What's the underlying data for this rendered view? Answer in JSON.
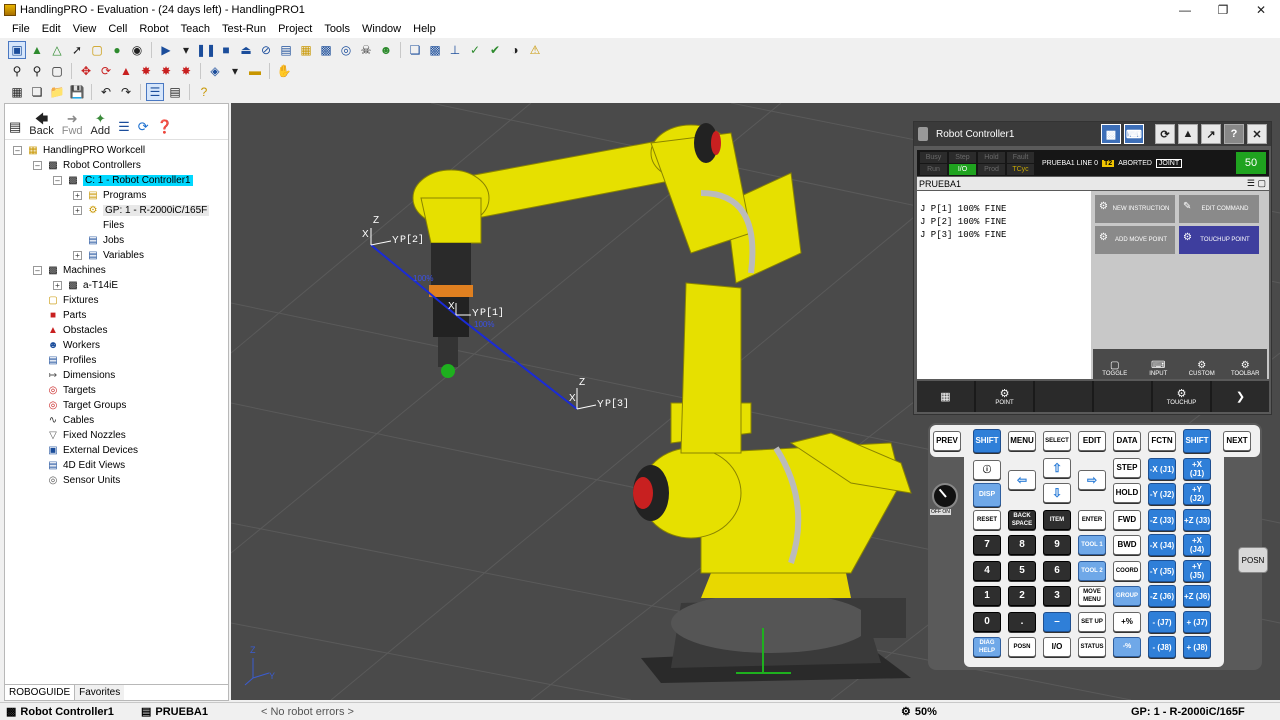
{
  "window": {
    "title": "HandlingPRO - Evaluation - (24 days left) - HandlingPRO1"
  },
  "menu": [
    "File",
    "Edit",
    "View",
    "Cell",
    "Robot",
    "Teach",
    "Test-Run",
    "Project",
    "Tools",
    "Window",
    "Help"
  ],
  "nav": {
    "back": "Back",
    "fwd": "Fwd",
    "add": "Add"
  },
  "tree": {
    "root": "HandlingPRO Workcell",
    "robot_controllers": "Robot Controllers",
    "controller": "C: 1 - Robot Controller1",
    "programs": "Programs",
    "gp": "GP: 1 - R-2000iC/165F",
    "files": "Files",
    "jobs": "Jobs",
    "variables": "Variables",
    "machines": "Machines",
    "machine_child": "a-T14iE",
    "fixtures": "Fixtures",
    "parts": "Parts",
    "obstacles": "Obstacles",
    "workers": "Workers",
    "profiles": "Profiles",
    "dimensions": "Dimensions",
    "targets": "Targets",
    "target_groups": "Target Groups",
    "cables": "Cables",
    "fixed_nozzles": "Fixed Nozzles",
    "external_devices": "External Devices",
    "edit_views": "4D Edit Views",
    "sensor_units": "Sensor Units"
  },
  "left_tabs": {
    "roboguide": "ROBOGUIDE",
    "favorites": "Favorites"
  },
  "viewport": {
    "labels": {
      "p1": "P[1]",
      "p2": "P[2]",
      "p3": "P[3]",
      "y_letter": "Y",
      "z_letter": "Z",
      "x_letter": "X",
      "speed1": "100%",
      "speed2": "100%"
    },
    "triad": {
      "z": "Z",
      "y": "Y"
    }
  },
  "pendant": {
    "title": "Robot Controller1",
    "leds": [
      "Busy",
      "Step",
      "Hold",
      "Fault",
      "Run",
      "I/O",
      "Prod",
      "TCyc"
    ],
    "leds_on": [
      "I/O"
    ],
    "status_prog": "PRUEBA1 LINE 0",
    "status_t2": "T2",
    "status_state": "ABORTED",
    "status_joint": "JOINT",
    "override": "50",
    "program_name": "PRUEBA1",
    "lines": [
      "J  P[1] 100% FINE",
      "J  P[2] 100% FINE",
      "J  P[3] 100% FINE"
    ],
    "commands": [
      {
        "label": "NEW INSTRUCTION",
        "blue": false
      },
      {
        "label": "EDIT COMMAND",
        "blue": false
      },
      {
        "label": "ADD MOVE POINT",
        "blue": false
      },
      {
        "label": "TOUCHUP POINT",
        "blue": true
      }
    ],
    "mini": [
      "TOGGLE",
      "INPUT",
      "CUSTOM",
      "TOOLBAR"
    ],
    "fkeys": [
      "",
      "POINT",
      "",
      "",
      "TOUCHUP",
      ""
    ]
  },
  "keypad": {
    "prev": "PREV",
    "shift": "SHIFT",
    "menu": "MENU",
    "select": "SELECT",
    "edit": "EDIT",
    "data": "DATA",
    "fctn": "FCTN",
    "next": "NEXT",
    "step": "STEP",
    "hold": "HOLD",
    "fwd": "FWD",
    "bwd": "BWD",
    "disp": "DISP",
    "reset": "RESET",
    "backspace": "BACK SPACE",
    "item": "ITEM",
    "enter": "ENTER",
    "tool1": "TOOL 1",
    "tool2": "TOOL 2",
    "coord": "COORD",
    "group": "GROUP",
    "move_menu": "MOVE MENU",
    "setup": "SET UP",
    "diag": "DIAG HELP",
    "posn": "POSN",
    "io": "I/O",
    "status": "STATUS",
    "posn_side": "POSN",
    "offon": "OFF  ON",
    "nums": [
      "7",
      "8",
      "9",
      "4",
      "5",
      "6",
      "1",
      "2",
      "3",
      "0",
      "."
    ],
    "jog_minus": [
      "-X (J1)",
      "-Y (J2)",
      "-Z (J3)",
      "-X (J4)",
      "-Y (J5)",
      "-Z (J6)",
      "- (J7)",
      "- (J8)"
    ],
    "jog_plus": [
      "+X (J1)",
      "+Y (J2)",
      "+Z (J3)",
      "+X (J4)",
      "+Y (J5)",
      "+Z (J6)",
      "+ (J7)",
      "+ (J8)"
    ],
    "plus_pct": "+%",
    "minus_pct": "-%"
  },
  "statusbar": {
    "controller": "Robot Controller1",
    "program": "PRUEBA1",
    "errors": "< No robot errors >",
    "zoom": "50%",
    "gp": "GP: 1 - R-2000iC/165F"
  },
  "colors": {
    "accent": "#00d8ff",
    "viewport": "#4a4a4a",
    "robot_yellow": "#f0e000",
    "path_blue": "#1a2bd8",
    "key_blue": "#2f7fd8"
  }
}
